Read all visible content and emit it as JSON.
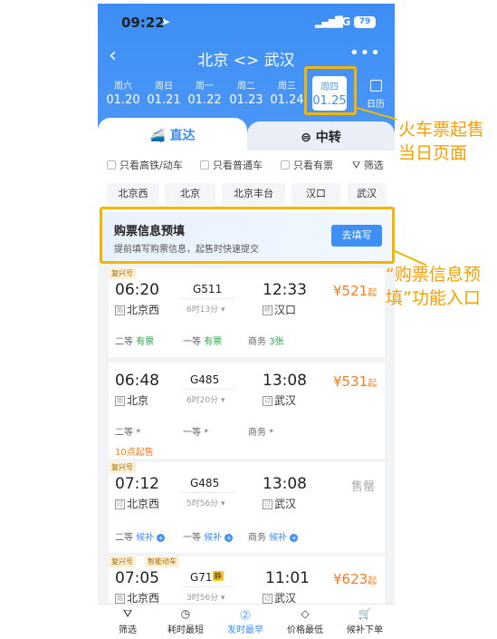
{
  "status": {
    "time": "09:22",
    "network": "5G",
    "battery": "79"
  },
  "nav": {
    "title": "北京 <> 武汉"
  },
  "dates": [
    {
      "weekday": "周六",
      "date": "01.20"
    },
    {
      "weekday": "周日",
      "date": "01.21"
    },
    {
      "weekday": "周一",
      "date": "01.22"
    },
    {
      "weekday": "周二",
      "date": "01.23"
    },
    {
      "weekday": "周三",
      "date": "01.24"
    },
    {
      "weekday": "周四",
      "date": "01.25"
    }
  ],
  "calendar_label": "日历",
  "tabs": {
    "direct": "直达",
    "transfer": "中转"
  },
  "filters": [
    "只看高铁/动车",
    "只看普通车",
    "只看有票",
    "筛选"
  ],
  "stations": [
    "北京西",
    "北京",
    "北京丰台",
    "汉口",
    "武汉"
  ],
  "prefill": {
    "title": "购票信息预填",
    "subtitle": "提前填写购票信息，起售时快速提交",
    "button": "去填写"
  },
  "trains": [
    {
      "badge": "复兴号",
      "dep": "06:20",
      "no": "G511",
      "duration": "6时13分",
      "arr": "12:33",
      "from": "北京西",
      "from_tag": "始",
      "to": "汉口",
      "to_tag": "终",
      "price": "¥521",
      "price_suffix": "起",
      "seats": [
        {
          "cls": "二等",
          "avail": "有票"
        },
        {
          "cls": "一等",
          "avail": "有票"
        },
        {
          "cls": "商务",
          "avail": "3张"
        }
      ]
    },
    {
      "badge": "",
      "dep": "06:48",
      "no": "G485",
      "duration": "6时20分",
      "arr": "13:08",
      "from": "北京",
      "from_tag": "始",
      "to": "武汉",
      "to_tag": "过",
      "price": "¥531",
      "price_suffix": "起",
      "seats": [
        {
          "cls": "二等",
          "avail": "*"
        },
        {
          "cls": "一等",
          "avail": "*"
        },
        {
          "cls": "商务",
          "avail": "*"
        }
      ],
      "note": "10点起售"
    },
    {
      "badge": "复兴号",
      "dep": "07:12",
      "no": "G485",
      "duration": "5时56分",
      "arr": "13:08",
      "from": "北京西",
      "from_tag": "过",
      "to": "武汉",
      "to_tag": "过",
      "status": "售罄",
      "seats": [
        {
          "cls": "二等",
          "avail": "候补"
        },
        {
          "cls": "一等",
          "avail": "候补"
        },
        {
          "cls": "商务",
          "avail": "候补"
        }
      ]
    },
    {
      "badge": "复兴号",
      "badge2": "智能动车",
      "dep": "07:05",
      "no": "G71",
      "rest": "静",
      "duration": "3时56分",
      "arr": "11:01",
      "from": "北京西",
      "from_tag": "始",
      "to": "武汉",
      "to_tag": "过",
      "price": "¥623",
      "price_suffix": "起"
    }
  ],
  "bottom_bar": [
    "筛选",
    "耗时最短",
    "发时最早",
    "价格最低",
    "候补下单"
  ],
  "annotations": {
    "a1_line1": "火车票起售",
    "a1_line2": "当日页面",
    "a2_line1": "“购票信息预",
    "a2_line2": "填”功能入口"
  },
  "colors": {
    "primary": "#3d8ef5",
    "highlight": "#f5b400",
    "price": "#f57c22",
    "available": "#2fa84f"
  }
}
